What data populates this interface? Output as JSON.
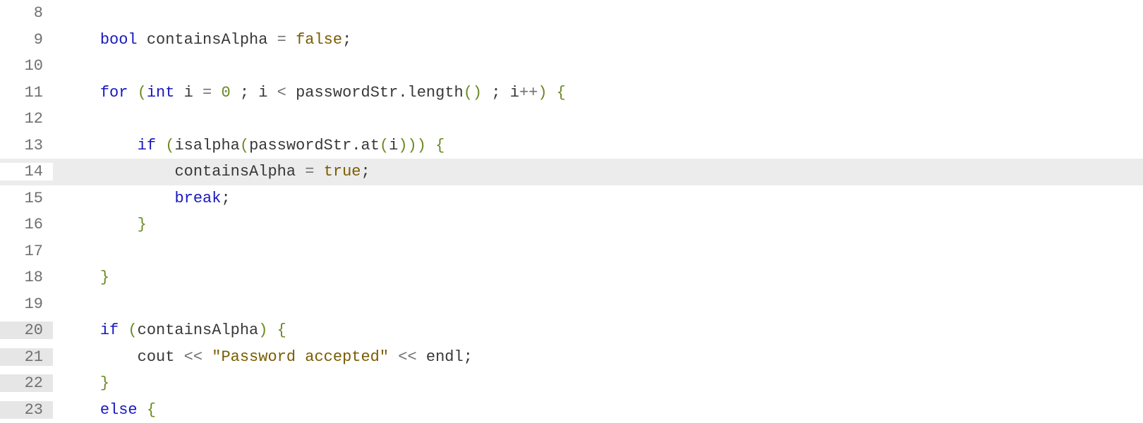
{
  "lines": [
    {
      "num": "8",
      "gutter_mod": false,
      "highlighted": false,
      "indent": 0,
      "tokens": []
    },
    {
      "num": "9",
      "gutter_mod": false,
      "highlighted": false,
      "indent": 1,
      "tokens": [
        {
          "t": "type",
          "v": "bool"
        },
        {
          "t": "sp",
          "v": " "
        },
        {
          "t": "ident",
          "v": "containsAlpha"
        },
        {
          "t": "sp",
          "v": " "
        },
        {
          "t": "op",
          "v": "="
        },
        {
          "t": "sp",
          "v": " "
        },
        {
          "t": "bool",
          "v": "false"
        },
        {
          "t": "punct",
          "v": ";"
        }
      ]
    },
    {
      "num": "10",
      "gutter_mod": false,
      "highlighted": false,
      "indent": 0,
      "tokens": []
    },
    {
      "num": "11",
      "gutter_mod": false,
      "highlighted": false,
      "indent": 1,
      "tokens": [
        {
          "t": "kw",
          "v": "for"
        },
        {
          "t": "sp",
          "v": " "
        },
        {
          "t": "paren",
          "v": "("
        },
        {
          "t": "type",
          "v": "int"
        },
        {
          "t": "sp",
          "v": " "
        },
        {
          "t": "ident",
          "v": "i"
        },
        {
          "t": "sp",
          "v": " "
        },
        {
          "t": "op",
          "v": "="
        },
        {
          "t": "sp",
          "v": " "
        },
        {
          "t": "num",
          "v": "0"
        },
        {
          "t": "sp",
          "v": " "
        },
        {
          "t": "punct",
          "v": ";"
        },
        {
          "t": "sp",
          "v": " "
        },
        {
          "t": "ident",
          "v": "i"
        },
        {
          "t": "sp",
          "v": " "
        },
        {
          "t": "op",
          "v": "<"
        },
        {
          "t": "sp",
          "v": " "
        },
        {
          "t": "ident",
          "v": "passwordStr"
        },
        {
          "t": "punct",
          "v": "."
        },
        {
          "t": "call",
          "v": "length"
        },
        {
          "t": "paren",
          "v": "()"
        },
        {
          "t": "sp",
          "v": " "
        },
        {
          "t": "punct",
          "v": ";"
        },
        {
          "t": "sp",
          "v": " "
        },
        {
          "t": "ident",
          "v": "i"
        },
        {
          "t": "op",
          "v": "++"
        },
        {
          "t": "paren",
          "v": ")"
        },
        {
          "t": "sp",
          "v": " "
        },
        {
          "t": "brace",
          "v": "{"
        }
      ]
    },
    {
      "num": "12",
      "gutter_mod": false,
      "highlighted": false,
      "indent": 2,
      "tokens": []
    },
    {
      "num": "13",
      "gutter_mod": false,
      "highlighted": false,
      "indent": 2,
      "tokens": [
        {
          "t": "kw",
          "v": "if"
        },
        {
          "t": "sp",
          "v": " "
        },
        {
          "t": "paren",
          "v": "("
        },
        {
          "t": "call",
          "v": "isalpha"
        },
        {
          "t": "paren",
          "v": "("
        },
        {
          "t": "ident",
          "v": "passwordStr"
        },
        {
          "t": "punct",
          "v": "."
        },
        {
          "t": "call",
          "v": "at"
        },
        {
          "t": "paren",
          "v": "("
        },
        {
          "t": "ident",
          "v": "i"
        },
        {
          "t": "paren",
          "v": ")))"
        },
        {
          "t": "sp",
          "v": " "
        },
        {
          "t": "brace",
          "v": "{"
        }
      ]
    },
    {
      "num": "14",
      "gutter_mod": false,
      "highlighted": true,
      "indent": 3,
      "tokens": [
        {
          "t": "ident",
          "v": "containsAlpha"
        },
        {
          "t": "sp",
          "v": " "
        },
        {
          "t": "op",
          "v": "="
        },
        {
          "t": "sp",
          "v": " "
        },
        {
          "t": "bool",
          "v": "true"
        },
        {
          "t": "punct",
          "v": ";"
        }
      ]
    },
    {
      "num": "15",
      "gutter_mod": false,
      "highlighted": false,
      "indent": 3,
      "tokens": [
        {
          "t": "kw",
          "v": "break"
        },
        {
          "t": "punct",
          "v": ";"
        }
      ]
    },
    {
      "num": "16",
      "gutter_mod": false,
      "highlighted": false,
      "indent": 2,
      "tokens": [
        {
          "t": "brace",
          "v": "}"
        }
      ]
    },
    {
      "num": "17",
      "gutter_mod": false,
      "highlighted": false,
      "indent": 2,
      "tokens": []
    },
    {
      "num": "18",
      "gutter_mod": false,
      "highlighted": false,
      "indent": 1,
      "tokens": [
        {
          "t": "brace",
          "v": "}"
        }
      ]
    },
    {
      "num": "19",
      "gutter_mod": false,
      "highlighted": false,
      "indent": 0,
      "tokens": []
    },
    {
      "num": "20",
      "gutter_mod": true,
      "highlighted": false,
      "indent": 1,
      "tokens": [
        {
          "t": "kw",
          "v": "if"
        },
        {
          "t": "sp",
          "v": " "
        },
        {
          "t": "paren",
          "v": "("
        },
        {
          "t": "ident",
          "v": "containsAlpha"
        },
        {
          "t": "paren",
          "v": ")"
        },
        {
          "t": "sp",
          "v": " "
        },
        {
          "t": "brace",
          "v": "{"
        }
      ]
    },
    {
      "num": "21",
      "gutter_mod": true,
      "highlighted": false,
      "indent": 2,
      "tokens": [
        {
          "t": "ident",
          "v": "cout"
        },
        {
          "t": "sp",
          "v": " "
        },
        {
          "t": "op",
          "v": "<<"
        },
        {
          "t": "sp",
          "v": " "
        },
        {
          "t": "str",
          "v": "\"Password accepted\""
        },
        {
          "t": "sp",
          "v": " "
        },
        {
          "t": "op",
          "v": "<<"
        },
        {
          "t": "sp",
          "v": " "
        },
        {
          "t": "ident",
          "v": "endl"
        },
        {
          "t": "punct",
          "v": ";"
        }
      ]
    },
    {
      "num": "22",
      "gutter_mod": true,
      "highlighted": false,
      "indent": 1,
      "tokens": [
        {
          "t": "brace",
          "v": "}"
        }
      ]
    },
    {
      "num": "23",
      "gutter_mod": true,
      "highlighted": false,
      "indent": 1,
      "tokens": [
        {
          "t": "kw",
          "v": "else"
        },
        {
          "t": "sp",
          "v": " "
        },
        {
          "t": "brace",
          "v": "{"
        }
      ]
    }
  ],
  "indent_unit": "    "
}
